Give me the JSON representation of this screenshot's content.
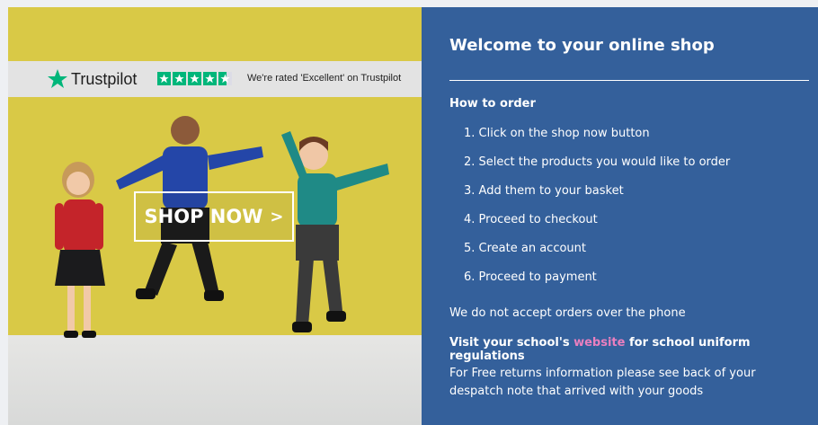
{
  "trustpilot": {
    "brand": "Trustpilot",
    "tagline": "We're rated 'Excellent' on Trustpilot",
    "rating_stars": 4.5,
    "star_color": "#00b67a"
  },
  "hero": {
    "cta_label": "SHOP NOW",
    "cta_chevron": ">"
  },
  "info": {
    "title": "Welcome to your online shop",
    "how_to_heading": "How to order",
    "steps": [
      "1. Click on the shop now button",
      "2. Select the products you would like to order",
      "3. Add them to your basket",
      "4. Proceed to checkout",
      "5. Create an account",
      "6. Proceed to payment"
    ],
    "phone_notice": "We do not accept orders over the phone",
    "visit_prefix": "Visit your school's ",
    "visit_link": "website",
    "visit_suffix": " for school uniform regulations",
    "returns_text": "For Free returns information please see back of your despatch note that arrived with your goods"
  },
  "colors": {
    "panel_blue": "#34609b",
    "hero_yellow": "#d9c946",
    "link_pink": "#ea7fbf"
  }
}
